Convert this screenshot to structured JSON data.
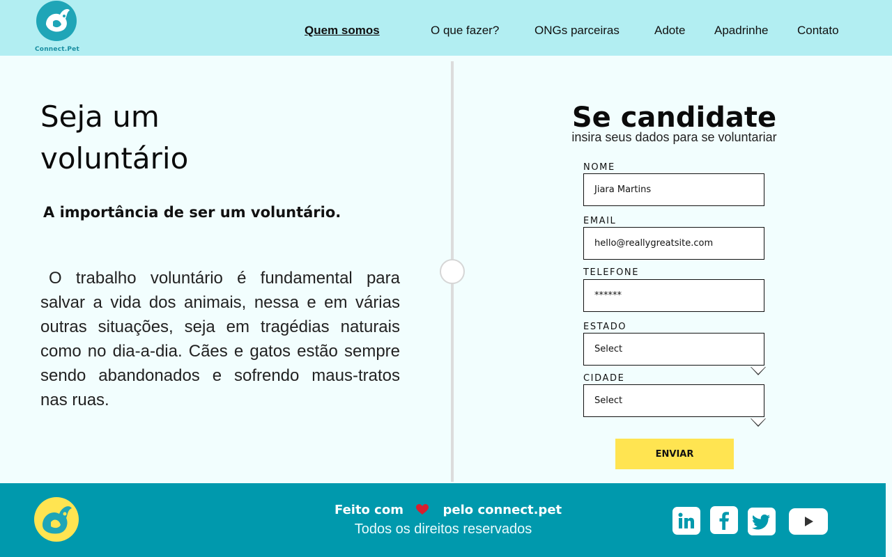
{
  "header": {
    "logo_text": "Connect.Pet",
    "nav": [
      {
        "label": "Quem somos",
        "active": true
      },
      {
        "label": "O que fazer?"
      },
      {
        "label": "ONGs parceiras"
      },
      {
        "label": "Adote"
      },
      {
        "label": "Apadrinhe"
      },
      {
        "label": "Contato"
      }
    ]
  },
  "hero": {
    "title_line1": "Seja um",
    "title_line2": "voluntário",
    "subtitle": "A importância de ser um voluntário.",
    "body": "O trabalho voluntário é fundamental para salvar a vida dos animais, nessa e em várias outras situações, seja em tragédias naturais como no dia-a-dia. Cães e gatos estão sempre sendo abandonados e sofrendo maus-tratos nas ruas."
  },
  "form": {
    "title": "Se candidate",
    "subtitle": "insira seus dados para se voluntariar",
    "fields": {
      "nome": {
        "label": "NOME",
        "value": "Jiara Martins"
      },
      "email": {
        "label": "EMAIL",
        "value": "hello@reallygreatsite.com"
      },
      "telefone": {
        "label": "TELEFONE",
        "value": "******"
      },
      "estado": {
        "label": "ESTADO",
        "value": "Select"
      },
      "cidade": {
        "label": "CIDADE",
        "value": "Select"
      }
    },
    "submit_label": "ENVIAR"
  },
  "footer": {
    "credit_prefix": "Feito com",
    "credit_suffix": "pelo connect.pet",
    "rights": "Todos os direitos reservados",
    "social": [
      "linkedin-icon",
      "facebook-icon",
      "twitter-icon",
      "youtube-icon"
    ]
  },
  "colors": {
    "header_bg": "#b2eef2",
    "page_bg": "#f2fefe",
    "footer_bg": "#0099ad",
    "accent_yellow": "#ffe451",
    "heart": "#d71f2e"
  }
}
